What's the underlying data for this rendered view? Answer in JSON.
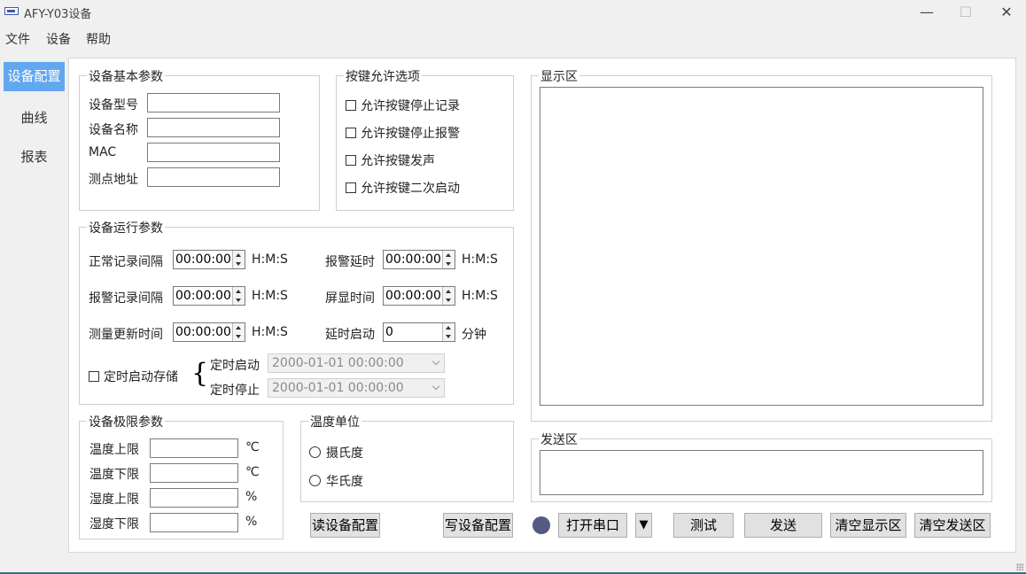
{
  "window": {
    "title": "AFY-Y03设备",
    "minimize": "—",
    "maximize": "☐",
    "close": "✕"
  },
  "menu": [
    "文件",
    "设备",
    "帮助"
  ],
  "sidebar": [
    "设备配置",
    "曲线",
    "报表"
  ],
  "basic": {
    "title": "设备基本参数",
    "fields": [
      {
        "label": "设备型号",
        "value": ""
      },
      {
        "label": "设备名称",
        "value": ""
      },
      {
        "label": "MAC",
        "value": ""
      },
      {
        "label": "测点地址",
        "value": ""
      }
    ]
  },
  "keys": {
    "title": "按键允许选项",
    "options": [
      {
        "label": "允许按键停止记录",
        "checked": false
      },
      {
        "label": "允许按键停止报警",
        "checked": false
      },
      {
        "label": "允许按键发声",
        "checked": false
      },
      {
        "label": "允许按键二次启动",
        "checked": false
      }
    ]
  },
  "run": {
    "title": "设备运行参数",
    "left": [
      {
        "label": "正常记录间隔",
        "value": "00:00:00",
        "unit": "H:M:S"
      },
      {
        "label": "报警记录间隔",
        "value": "00:00:00",
        "unit": "H:M:S"
      },
      {
        "label": "测量更新时间",
        "value": "00:00:00",
        "unit": "H:M:S"
      }
    ],
    "right": [
      {
        "label": "报警延时",
        "value": "00:00:00",
        "unit": "H:M:S"
      },
      {
        "label": "屏显时间",
        "value": "00:00:00",
        "unit": "H:M:S"
      },
      {
        "label": "延时启动",
        "value": "0",
        "unit": "分钟"
      }
    ],
    "timer": {
      "label": "定时启动存储",
      "brace": "{",
      "start_label": "定时启动",
      "start_value": "2000-01-01 00:00:00",
      "stop_label": "定时停止",
      "stop_value": "2000-01-01 00:00:00"
    }
  },
  "limits": {
    "title": "设备极限参数",
    "fields": [
      {
        "label": "温度上限",
        "value": "",
        "unit": "℃"
      },
      {
        "label": "温度下限",
        "value": "",
        "unit": "℃"
      },
      {
        "label": "湿度上限",
        "value": "",
        "unit": "%"
      },
      {
        "label": "湿度下限",
        "value": "",
        "unit": "%"
      }
    ]
  },
  "tempunit": {
    "title": "温度单位",
    "options": [
      "摄氏度",
      "华氏度"
    ]
  },
  "buttons": {
    "read": "读设备配置",
    "write": "写设备配置",
    "open": "打开串口",
    "dropdown": "▼",
    "test": "测试",
    "send": "发送",
    "clear_display": "清空显示区",
    "clear_send": "清空发送区"
  },
  "display": {
    "title": "显示区",
    "content": ""
  },
  "sendarea": {
    "title": "发送区",
    "content": ""
  },
  "colors": {
    "accent": "#62a8f0",
    "status": "#555a82"
  }
}
